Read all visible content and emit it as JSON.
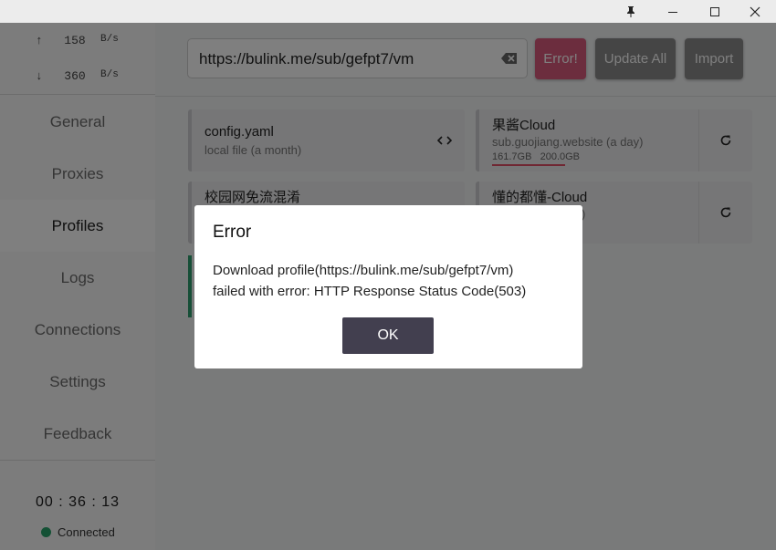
{
  "titlebar": {
    "pin_icon": "pin-icon",
    "minimize_icon": "minimize-icon",
    "maximize_icon": "maximize-icon",
    "close_icon": "close-icon"
  },
  "sidebar": {
    "upload": {
      "arrow": "↑",
      "value": "158",
      "unit": "B/s"
    },
    "download": {
      "arrow": "↓",
      "value": "360",
      "unit": "B/s"
    },
    "nav": [
      "General",
      "Proxies",
      "Profiles",
      "Logs",
      "Connections",
      "Settings",
      "Feedback"
    ],
    "active": "Profiles",
    "clock": "00 : 36 : 13",
    "status": "Connected",
    "status_color": "#29a36a"
  },
  "toolbar": {
    "url_value": "https://bulink.me/sub/gefpt7/vm",
    "error_label": "Error!",
    "update_label": "Update All",
    "import_label": "Import",
    "error_color": "#d95b7c"
  },
  "profiles": [
    {
      "name": "config.yaml",
      "sub": "local file (a month)",
      "icon": "code-icon"
    },
    {
      "name": "果酱Cloud",
      "sub": "sub.guojiang.website (a day)",
      "used": "161.7GB",
      "total": "200.0GB",
      "icon": "refresh-icon"
    },
    {
      "name": "校园网免流混淆",
      "icon": ""
    },
    {
      "name": "懂的都懂-Cloud",
      "sub": ")",
      "icon": "refresh-icon"
    }
  ],
  "dialog": {
    "title": "Error",
    "message_line1": "Download profile(https://bulink.me/sub/gefpt7/vm)",
    "message_line2": "failed with error: HTTP Response Status Code(503)",
    "ok_label": "OK"
  }
}
